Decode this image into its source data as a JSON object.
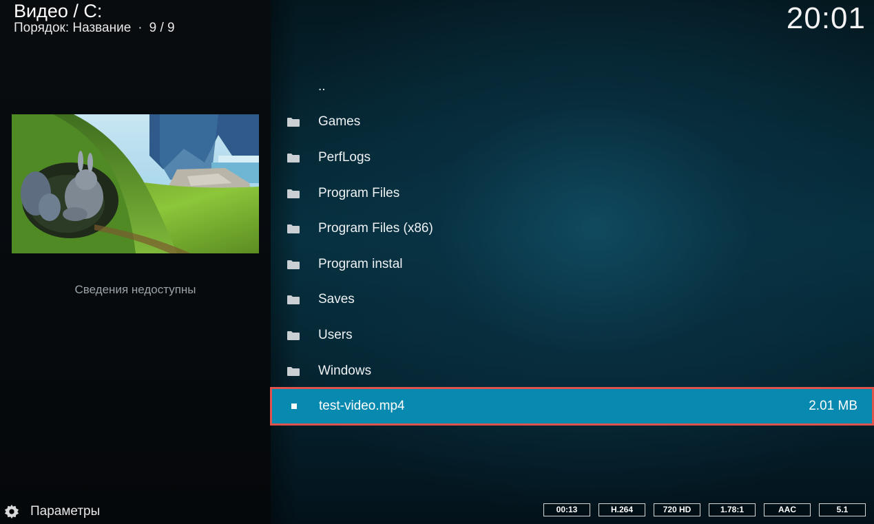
{
  "header": {
    "title": "Видео / C:",
    "sort_label": "Порядок: Название",
    "separator": "·",
    "count": "9 / 9"
  },
  "clock": "20:01",
  "info": {
    "no_info": "Сведения недоступны"
  },
  "list": {
    "items": [
      {
        "label": "..",
        "icon": "none",
        "size": ""
      },
      {
        "label": "Games",
        "icon": "folder-icon",
        "size": ""
      },
      {
        "label": "PerfLogs",
        "icon": "folder-icon",
        "size": ""
      },
      {
        "label": "Program Files",
        "icon": "folder-icon",
        "size": ""
      },
      {
        "label": "Program Files (x86)",
        "icon": "folder-icon",
        "size": ""
      },
      {
        "label": "Program instal",
        "icon": "folder-icon",
        "size": ""
      },
      {
        "label": "Saves",
        "icon": "folder-icon",
        "size": ""
      },
      {
        "label": "Users",
        "icon": "folder-icon",
        "size": ""
      },
      {
        "label": "Windows",
        "icon": "folder-icon",
        "size": ""
      },
      {
        "label": "test-video.mp4",
        "icon": "video-file-icon",
        "size": "2.01 MB",
        "selected": true
      }
    ]
  },
  "footer": {
    "settings_label": "Параметры",
    "badges": [
      "00:13",
      "H.264",
      "720 HD",
      "1.78:1",
      "AAC",
      "5.1"
    ]
  },
  "colors": {
    "selection": "#0889b0",
    "highlight_outline": "#e0524c"
  }
}
